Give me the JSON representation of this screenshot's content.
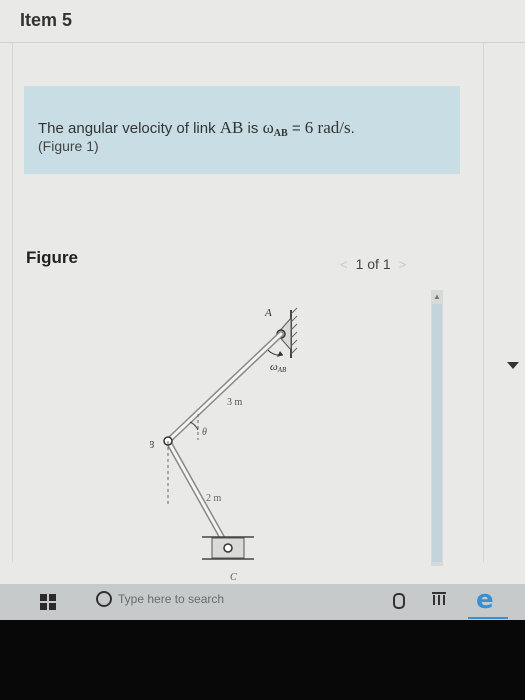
{
  "page": {
    "item_title": "Item 5"
  },
  "question": {
    "prefix": "The angular velocity of link ",
    "link": "AB",
    "is": " is ",
    "omega": "ω",
    "omega_sub": "AB",
    "equals": " = ",
    "value": "6",
    "unit": " rad/s",
    "end": ".",
    "figure_ref": "(Figure 1)"
  },
  "figure": {
    "label": "Figure",
    "pager": {
      "prev": "<",
      "text": "1 of 1",
      "next": ">"
    },
    "labels": {
      "A": "A",
      "B": "B",
      "C": "C",
      "omega": "ω",
      "omega_sub": "AB",
      "len_ab": "3 m",
      "len_bc": "2 m",
      "theta": "θ"
    }
  },
  "taskbar": {
    "search_placeholder": "Type here to search",
    "edge_glyph": "e",
    "colors": {
      "edge": "#3b8fd1",
      "taskbar": "#c7cacb"
    }
  }
}
